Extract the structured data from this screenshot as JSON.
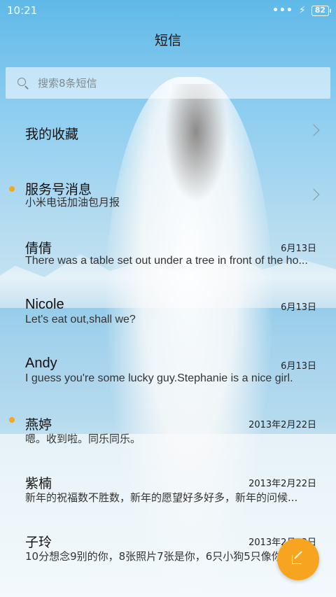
{
  "status_bar": {
    "time": "10:21",
    "signal_dots": "•••",
    "charging_icon": "bolt-icon",
    "battery": "82"
  },
  "header": {
    "title": "短信"
  },
  "search": {
    "placeholder": "搜索8条短信",
    "icon": "search-icon"
  },
  "list": [
    {
      "name": "我的收藏",
      "snippet": "",
      "date": "",
      "unread": false,
      "chevron": true
    },
    {
      "name": "服务号消息",
      "snippet": "小米电话加油包月报",
      "date": "",
      "unread": true,
      "chevron": true
    },
    {
      "name": "倩倩",
      "snippet": "There was a table set out under a tree in front of the ho...",
      "date": "6月13日",
      "unread": false
    },
    {
      "name": "Nicole",
      "snippet": "Let's eat out,shall we?",
      "date": "6月13日",
      "unread": false
    },
    {
      "name": "Andy",
      "snippet": "I guess you're some lucky guy.Stephanie is a nice girl.",
      "date": "6月13日",
      "unread": false
    },
    {
      "name": "燕婷",
      "snippet": "嗯。收到啦。同乐同乐。",
      "date": "2013年2月22日",
      "unread": true
    },
    {
      "name": "紫楠",
      "snippet": "新年的祝福数不胜数，新年的愿望好多好多，新年的问候...",
      "date": "2013年2月22日",
      "unread": false
    },
    {
      "name": "子玲",
      "snippet": "10分想念9别的你，8张照片7张是你，6只小狗5只像你...",
      "date": "2013年2月22日",
      "unread": false
    }
  ],
  "fab": {
    "icon": "compose-icon"
  },
  "colors": {
    "accent": "#f7a520",
    "unread_dot": "#f5a623"
  }
}
